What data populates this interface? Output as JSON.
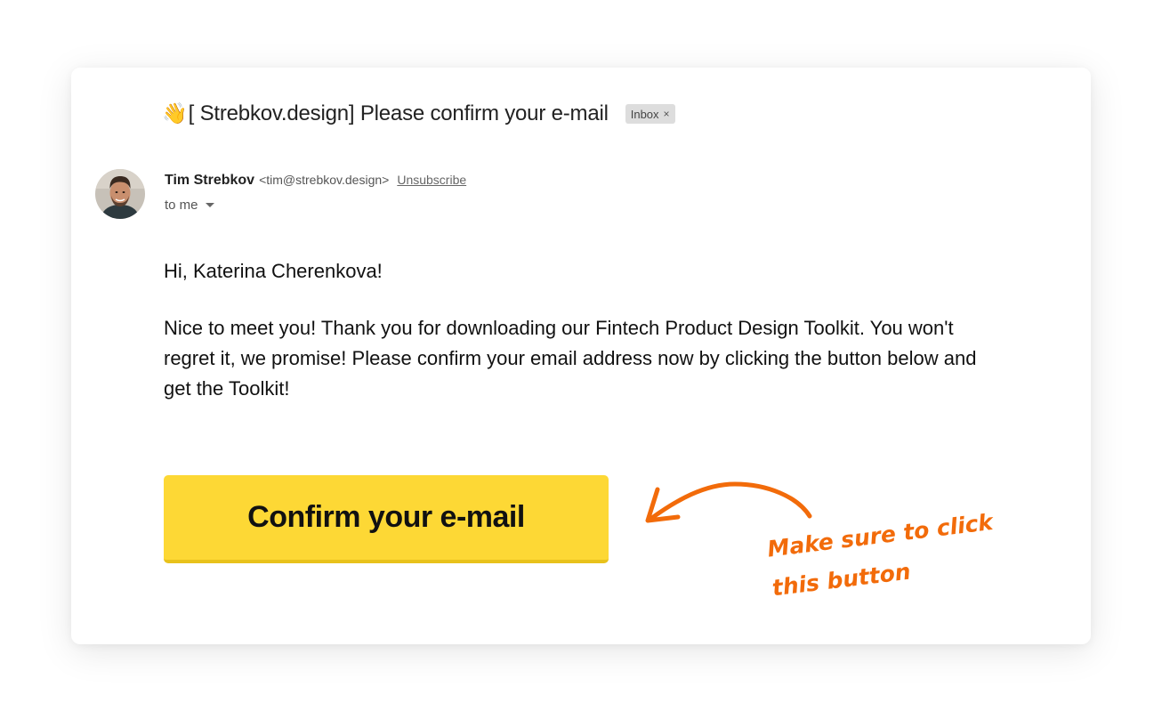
{
  "email": {
    "emoji": "👋",
    "subject": "[ Strebkov.design] Please confirm your e-mail",
    "label": "Inbox",
    "label_close": "×",
    "sender": {
      "name": "Tim Strebkov",
      "email": "<tim@strebkov.design>",
      "unsubscribe": "Unsubscribe",
      "recipient": "to me"
    },
    "greeting": "Hi, Katerina Cherenkova!",
    "body": "Nice to meet you! Thank you for downloading our Fintech Product Design Toolkit. You won't regret it, we promise! Please confirm your email address now by clicking the button below and get the Toolkit!",
    "cta_label": "Confirm your e-mail"
  },
  "annotation": {
    "line1": "Make sure to click",
    "line2": "this button"
  },
  "colors": {
    "cta_bg": "#fdd835",
    "annotation": "#f26b0a",
    "label_bg": "#dddddd"
  }
}
